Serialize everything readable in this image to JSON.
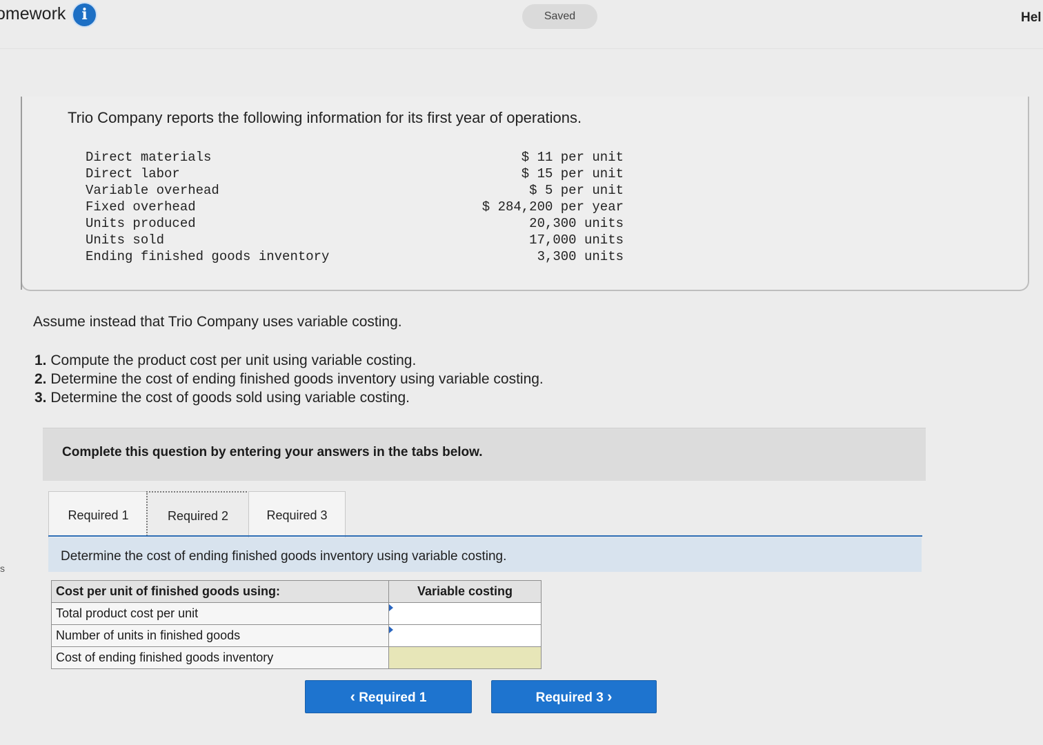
{
  "header": {
    "app_title": "omework",
    "info_icon": "i",
    "saved_label": "Saved",
    "help_label": "Hel",
    "side_letter": "s"
  },
  "problem": {
    "intro": "Trio Company reports the following information for its first year of operations.",
    "rows": [
      {
        "label": "Direct materials",
        "value": "$ 11 per unit"
      },
      {
        "label": "Direct labor",
        "value": "$ 15 per unit"
      },
      {
        "label": "Variable overhead",
        "value": "$ 5 per unit"
      },
      {
        "label": "Fixed overhead",
        "value": "$ 284,200 per year"
      },
      {
        "label": "Units produced",
        "value": "20,300 units"
      },
      {
        "label": "Units sold",
        "value": "17,000 units"
      },
      {
        "label": "Ending finished goods inventory",
        "value": "3,300 units"
      }
    ],
    "assume": "Assume instead that Trio Company uses variable costing.",
    "requirements": [
      {
        "num": "1.",
        "text": " Compute the product cost per unit using variable costing."
      },
      {
        "num": "2.",
        "text": " Determine the cost of ending finished goods inventory using variable costing."
      },
      {
        "num": "3.",
        "text": " Determine the cost of goods sold using variable costing."
      }
    ]
  },
  "banner": {
    "text": "Complete this question by entering your answers in the tabs below."
  },
  "tabs": [
    {
      "label": "Required 1"
    },
    {
      "label": "Required 2"
    },
    {
      "label": "Required 3"
    }
  ],
  "prompt": "Determine the cost of ending finished goods inventory using variable costing.",
  "answer_table": {
    "header_label": "Cost per unit of finished goods using:",
    "header_col": "Variable costing",
    "rows": [
      {
        "label": "Total product cost per unit",
        "value": ""
      },
      {
        "label": "Number of units in finished goods",
        "value": ""
      },
      {
        "label": "Cost of ending finished goods inventory",
        "value": ""
      }
    ]
  },
  "nav": {
    "prev_label": "Required 1",
    "next_label": "Required 3",
    "prev_icon": "‹",
    "next_icon": "›"
  },
  "colors": {
    "accent": "#1e74cf",
    "highlight_cell": "#e7e6b8"
  }
}
